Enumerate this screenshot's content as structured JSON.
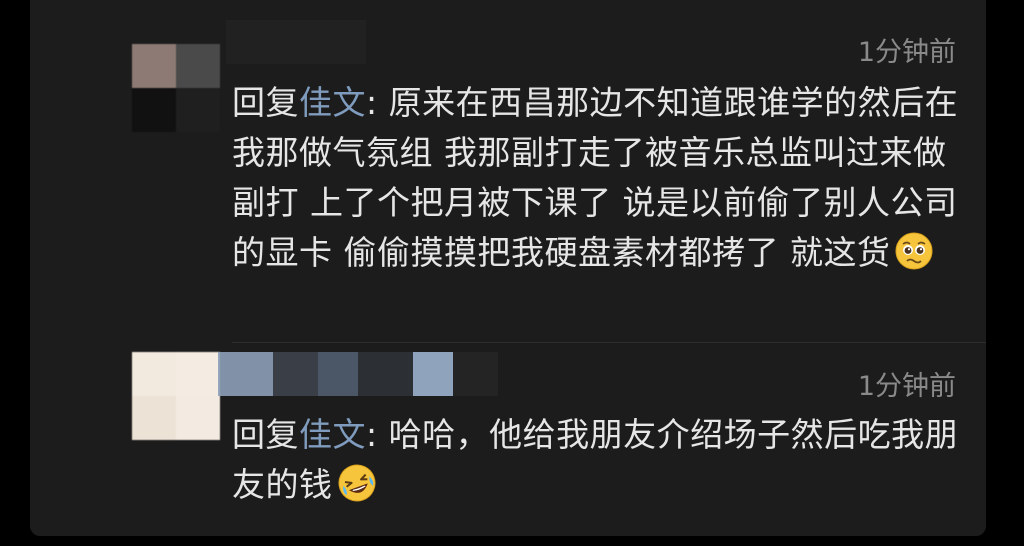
{
  "comments": [
    {
      "time": "1分钟前",
      "reply_prefix": "回复",
      "mention": "佳文",
      "separator": ": ",
      "text": "原来在西昌那边不知道跟谁学的然后在我那做气氛组 我那副打走了被音乐总监叫过来做副打 上了个把月被下课了 说是以前偷了别人公司的显卡 偷偷摸摸把我硬盘素材都拷了 就这货",
      "emoji": "pleading-face-icon"
    },
    {
      "time": "1分钟前",
      "reply_prefix": "回复",
      "mention": "佳文",
      "separator": ": ",
      "text": "哈哈，他给我朋友介绍场子然后吃我朋友的钱",
      "emoji": "rolling-laughing-face-icon"
    }
  ],
  "colors": {
    "background": "#000000",
    "card": "#1c1c1c",
    "text": "#e6e6e6",
    "mention": "#7f9bbd",
    "timestamp": "#8a8a8a"
  }
}
